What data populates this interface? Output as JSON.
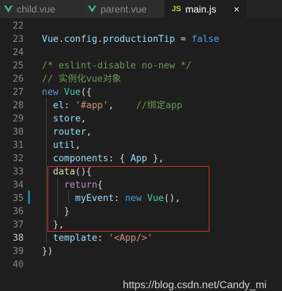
{
  "tabs": [
    {
      "label": "child.vue",
      "icon": "vue-icon"
    },
    {
      "label": "parent.vue",
      "icon": "vue-icon"
    },
    {
      "label": "main.js",
      "icon": "js-icon",
      "icon_text": "JS",
      "close": "×",
      "active": true
    }
  ],
  "lines": [
    {
      "num": "22",
      "tokens": []
    },
    {
      "num": "23",
      "tokens": [
        {
          "t": "Vue",
          "c": "var"
        },
        {
          "t": ".",
          "c": "op"
        },
        {
          "t": "config",
          "c": "var"
        },
        {
          "t": ".",
          "c": "op"
        },
        {
          "t": "productionTip",
          "c": "var"
        },
        {
          "t": " = ",
          "c": "op"
        },
        {
          "t": "false",
          "c": "kw"
        }
      ]
    },
    {
      "num": "24",
      "tokens": []
    },
    {
      "num": "25",
      "tokens": [
        {
          "t": "/* eslint-disable no-new */",
          "c": "com"
        }
      ]
    },
    {
      "num": "26",
      "tokens": [
        {
          "t": "// 实例化vue对象",
          "c": "com"
        }
      ]
    },
    {
      "num": "27",
      "tokens": [
        {
          "t": "new",
          "c": "kw"
        },
        {
          "t": " ",
          "c": "op"
        },
        {
          "t": "Vue",
          "c": "cls"
        },
        {
          "t": "({",
          "c": "op"
        }
      ]
    },
    {
      "num": "28",
      "tokens": [
        {
          "t": "  el",
          "c": "prop"
        },
        {
          "t": ": ",
          "c": "op"
        },
        {
          "t": "'#app'",
          "c": "str"
        },
        {
          "t": ",    ",
          "c": "op"
        },
        {
          "t": "//绑定app",
          "c": "com"
        }
      ]
    },
    {
      "num": "29",
      "tokens": [
        {
          "t": "  store",
          "c": "prop"
        },
        {
          "t": ",",
          "c": "op"
        }
      ]
    },
    {
      "num": "30",
      "tokens": [
        {
          "t": "  router",
          "c": "prop"
        },
        {
          "t": ",",
          "c": "op"
        }
      ]
    },
    {
      "num": "31",
      "tokens": [
        {
          "t": "  util",
          "c": "prop"
        },
        {
          "t": ",",
          "c": "op"
        }
      ]
    },
    {
      "num": "32",
      "tokens": [
        {
          "t": "  components",
          "c": "prop"
        },
        {
          "t": ": { ",
          "c": "op"
        },
        {
          "t": "App",
          "c": "prop"
        },
        {
          "t": " },",
          "c": "op"
        }
      ]
    },
    {
      "num": "33",
      "tokens": [
        {
          "t": "  data",
          "c": "fn"
        },
        {
          "t": "(){",
          "c": "op"
        }
      ]
    },
    {
      "num": "34",
      "tokens": [
        {
          "t": "    return",
          "c": "ctl"
        },
        {
          "t": "{",
          "c": "op"
        }
      ]
    },
    {
      "num": "35",
      "tokens": [
        {
          "t": "      myEvent",
          "c": "prop"
        },
        {
          "t": ": ",
          "c": "op"
        },
        {
          "t": "new",
          "c": "kw"
        },
        {
          "t": " ",
          "c": "op"
        },
        {
          "t": "Vue",
          "c": "cls"
        },
        {
          "t": "(),",
          "c": "op"
        }
      ]
    },
    {
      "num": "36",
      "tokens": [
        {
          "t": "    }",
          "c": "op"
        }
      ]
    },
    {
      "num": "37",
      "tokens": [
        {
          "t": "  },",
          "c": "op"
        }
      ]
    },
    {
      "num": "38",
      "tokens": [
        {
          "t": "  template",
          "c": "prop"
        },
        {
          "t": ": ",
          "c": "op"
        },
        {
          "t": "'<App/>'",
          "c": "str"
        }
      ],
      "current": true
    },
    {
      "num": "39",
      "tokens": [
        {
          "t": "})",
          "c": "op"
        }
      ]
    },
    {
      "num": "40",
      "tokens": []
    }
  ],
  "watermark": "https://blog.csdn.net/Candy_mi",
  "colors": {
    "background": "#1e1e1e",
    "tabbar": "#252526",
    "highlight_box": "#d9342b",
    "modified_gutter": "#1b81a8",
    "vue_icon": "#41b883"
  }
}
